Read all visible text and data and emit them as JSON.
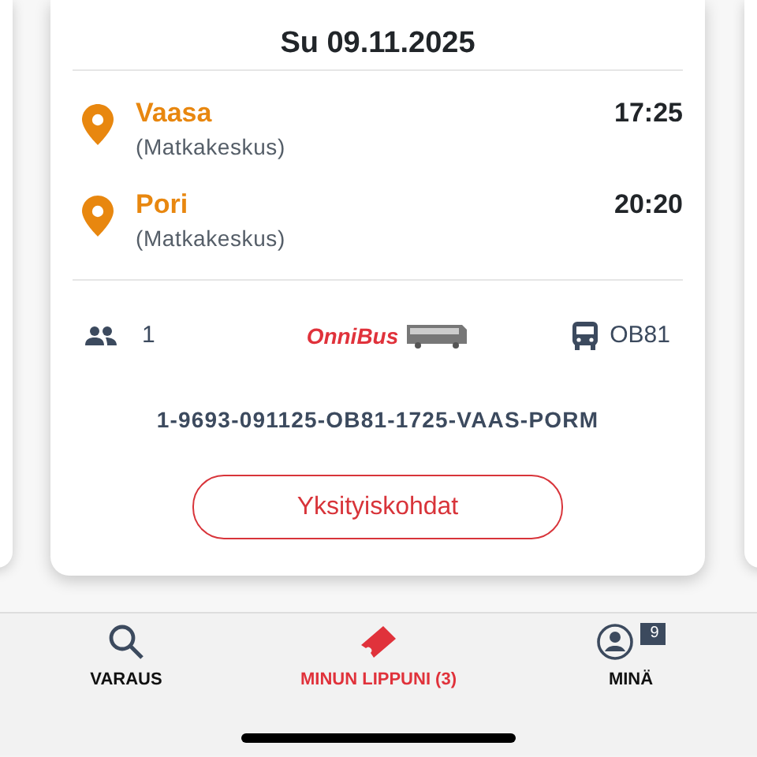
{
  "trip": {
    "date": "Su 09.11.2025",
    "stops": [
      {
        "city": "Vaasa",
        "station": "(Matkakeskus)",
        "time": "17:25"
      },
      {
        "city": "Pori",
        "station": "(Matkakeskus)",
        "time": "20:20"
      }
    ],
    "passengers": "1",
    "brand": "OnniBus",
    "line": "OB81",
    "ticket_code": "1-9693-091125-OB81-1725-VAAS-PORM",
    "details_button": "Yksityiskohdat"
  },
  "tab_bar": [
    {
      "label": "VARAUS",
      "kind": "search",
      "selected": false
    },
    {
      "label": "MINUN LIPPUNI (3)",
      "kind": "ticket",
      "selected": true
    },
    {
      "label": "MINÄ",
      "kind": "profile",
      "selected": false,
      "badge": "9"
    }
  ]
}
